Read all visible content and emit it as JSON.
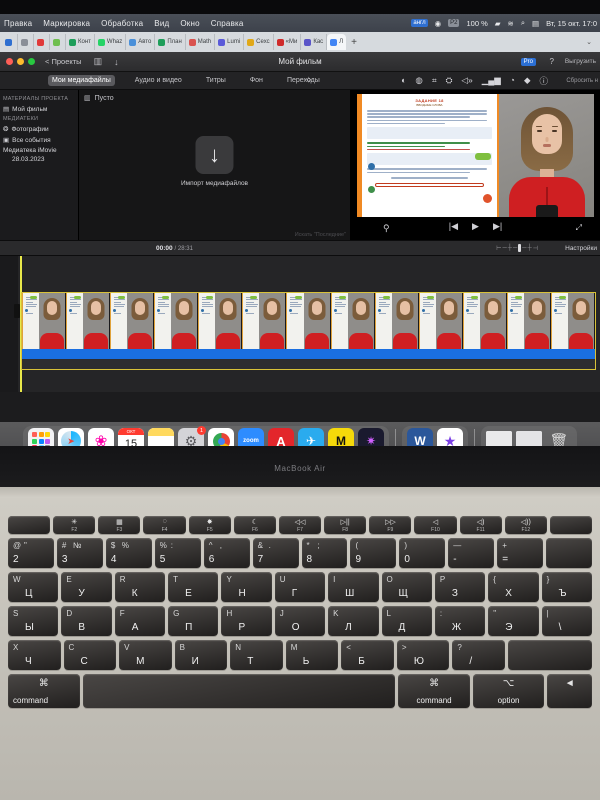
{
  "os_menubar": {
    "apple": "",
    "items": [
      "Правка",
      "Маркировка",
      "Обработка",
      "Вид",
      "Окно",
      "Справка"
    ],
    "status": {
      "input_badge": "англ",
      "record_badge": "P2",
      "battery_pct": "100 %",
      "wifi_icon": "wifi-icon",
      "search_icon": "search-icon",
      "control_center_icon": "control-center-icon",
      "datetime": "Вт, 15 окт. 17:0"
    }
  },
  "browser_tabs": {
    "tabs": [
      {
        "label": "",
        "color": "#2f6fd0"
      },
      {
        "label": "",
        "color": "#8a8f98"
      },
      {
        "label": "",
        "color": "#e03a3a"
      },
      {
        "label": "",
        "color": "#6fbf4f"
      },
      {
        "label": "Конт",
        "color": "#1e9e5a"
      },
      {
        "label": "Whaz",
        "color": "#25d366"
      },
      {
        "label": "Авто",
        "color": "#4a90d9"
      },
      {
        "label": "План",
        "color": "#1e9e5a"
      },
      {
        "label": "Math",
        "color": "#d9534f"
      },
      {
        "label": "Lumi",
        "color": "#5a5ad9"
      },
      {
        "label": "Сехс",
        "color": "#e0a818"
      },
      {
        "label": "«Ми",
        "color": "#cf2b2b"
      },
      {
        "label": "Кас",
        "color": "#5a55c8"
      },
      {
        "label": "Л",
        "color": "#4285f4"
      }
    ],
    "new_tab": "+",
    "tab_list_chevron": "⌄"
  },
  "imovie": {
    "title": "Мой фильм",
    "back_label": "< Проекты",
    "pro_badge": "Pro",
    "help_badge": "?",
    "share_label": "Выгрузить",
    "traffic_lights": [
      "#ff5f57",
      "#febc2e",
      "#28c840"
    ],
    "titlebar_icons": [
      "media-grid-icon",
      "download-icon"
    ],
    "tabs": [
      {
        "label": "Мои медиафайлы",
        "selected": true
      },
      {
        "label": "Аудио и видео",
        "selected": false
      },
      {
        "label": "Титры",
        "selected": false
      },
      {
        "label": "Фон",
        "selected": false
      },
      {
        "label": "Переходы",
        "selected": false
      }
    ],
    "magic_wand_icon": "magic-wand-icon",
    "adjust_icons": [
      "color-balance-icon",
      "color-correction-icon",
      "crop-icon",
      "stabilization-icon",
      "volume-icon",
      "equalizer-icon",
      "speed-icon",
      "filter-icon",
      "info-icon"
    ],
    "reset_label": "Сбросить н",
    "sidebar": {
      "section_project": "МАТЕРИАЛЫ ПРОЕКТА",
      "project_item": "Мой фильм",
      "section_libraries": "МЕДИАТЕКИ",
      "items": [
        {
          "label": "Фотографии",
          "icon": "photos-icon"
        },
        {
          "label": "Все события",
          "icon": "events-icon"
        }
      ],
      "library_name": "Медиатека iMovie",
      "library_date": "28.03.2023"
    },
    "browser": {
      "view_icon": "list-view-icon",
      "empty_label": "Пусто",
      "import_icon": "download-arrow-icon",
      "import_label": "Импорт медиафайлов",
      "search_hint": "Искать \"Последние\""
    },
    "preview": {
      "slide_title": "ЗАДАНИЕ 18",
      "slide_subtitle": "ВВОДНЫЕ СЛОВА",
      "controls": {
        "mic": "microphone-icon",
        "prev": "skip-back-icon",
        "play": "play-icon",
        "next": "skip-forward-icon",
        "fullscreen": "fullscreen-icon"
      }
    },
    "timeline_header": {
      "current_time": "00:00",
      "separator": "/",
      "total_time": "28:31",
      "zoom_slider_icon": "zoom-slider",
      "settings_label": "Настройки"
    },
    "timeline": {
      "clip_count": 13,
      "selection_color": "#d8c139",
      "audio_color": "#1a6fe0",
      "playhead_color": "#e8e84a"
    }
  },
  "dock": {
    "left_group": [
      {
        "name": "launchpad-icon",
        "glyph": "",
        "bg": "#f2f2f4"
      },
      {
        "name": "safari-icon",
        "glyph": "🧭",
        "bg": "#ffffff"
      },
      {
        "name": "photos-icon",
        "glyph": "❀",
        "bg": "#ffffff"
      },
      {
        "name": "calendar-icon",
        "glyph": "15",
        "bg": "#ffffff",
        "top": "ОКТ"
      },
      {
        "name": "notes-icon",
        "glyph": "",
        "bg": "#fde99a"
      },
      {
        "name": "settings-icon",
        "glyph": "⚙",
        "bg": "#d4d4d8",
        "badge": "1"
      },
      {
        "name": "chrome-icon",
        "glyph": "◉",
        "bg": "#ffffff"
      },
      {
        "name": "zoom-icon",
        "glyph": "zoom",
        "bg": "#2d8cff"
      },
      {
        "name": "acrobat-icon",
        "glyph": "A",
        "bg": "#e3262b"
      },
      {
        "name": "telegram-icon",
        "glyph": "✈",
        "bg": "#2aabee"
      },
      {
        "name": "movavi-icon",
        "glyph": "M",
        "bg": "#f5d90a"
      },
      {
        "name": "creative-icon",
        "glyph": "✷",
        "bg": "#1a1a2e"
      }
    ],
    "right_group": [
      {
        "name": "word-icon",
        "glyph": "W",
        "bg": "#2b579a"
      },
      {
        "name": "imovie-icon",
        "glyph": "★",
        "bg": "#ffffff"
      }
    ],
    "files_group": [
      {
        "name": "document-thumbnail-1",
        "glyph": "",
        "bg": "#e9e9ea"
      },
      {
        "name": "document-thumbnail-2",
        "glyph": "",
        "bg": "#e4e4e6"
      },
      {
        "name": "trash-icon",
        "glyph": "🗑",
        "bg": "transparent"
      }
    ]
  },
  "laptop": {
    "model_label": "MacBook Air",
    "fn_row": [
      {
        "glyph": "✳",
        "label": "F2"
      },
      {
        "glyph": "▦",
        "label": "F3"
      },
      {
        "glyph": "◌",
        "label": "F4"
      },
      {
        "glyph": "✸",
        "label": "F5"
      },
      {
        "glyph": "☾",
        "label": "F6"
      },
      {
        "glyph": "◁◁",
        "label": "F7"
      },
      {
        "glyph": "▷||",
        "label": "F8"
      },
      {
        "glyph": "▷▷",
        "label": "F9"
      },
      {
        "glyph": "◁",
        "label": "F10"
      },
      {
        "glyph": "◁)",
        "label": "F11"
      },
      {
        "glyph": "◁))",
        "label": "F12"
      }
    ],
    "number_row": [
      {
        "top": "@",
        "top2": "\"",
        "btm": "2"
      },
      {
        "top": "#",
        "top2": "№",
        "btm": "3"
      },
      {
        "top": "$",
        "top2": "%",
        "btm": "4"
      },
      {
        "top": "%",
        "top2": ":",
        "btm": "5"
      },
      {
        "top": "^",
        "top2": ",",
        "btm": "6"
      },
      {
        "top": "&",
        "top2": ".",
        "btm": "7"
      },
      {
        "top": "*",
        "top2": ";",
        "btm": "8"
      },
      {
        "top": "(",
        "top2": "",
        "btm": "9"
      },
      {
        "top": ")",
        "top2": "",
        "btm": "0"
      },
      {
        "top": "—",
        "top2": "",
        "btm": "-"
      },
      {
        "top": "+",
        "top2": "",
        "btm": "="
      }
    ],
    "qwerty_row": [
      {
        "lat": "W",
        "cyr": "Ц"
      },
      {
        "lat": "E",
        "cyr": "У"
      },
      {
        "lat": "R",
        "cyr": "К"
      },
      {
        "lat": "T",
        "cyr": "Е"
      },
      {
        "lat": "Y",
        "cyr": "Н"
      },
      {
        "lat": "U",
        "cyr": "Г"
      },
      {
        "lat": "I",
        "cyr": "Ш"
      },
      {
        "lat": "O",
        "cyr": "Щ"
      },
      {
        "lat": "P",
        "cyr": "З"
      },
      {
        "lat": "{",
        "cyr": "Х"
      },
      {
        "lat": "}",
        "cyr": "Ъ"
      }
    ],
    "asdf_row": [
      {
        "lat": "S",
        "cyr": "Ы"
      },
      {
        "lat": "D",
        "cyr": "В"
      },
      {
        "lat": "F",
        "cyr": "А"
      },
      {
        "lat": "G",
        "cyr": "П"
      },
      {
        "lat": "H",
        "cyr": "Р"
      },
      {
        "lat": "J",
        "cyr": "О"
      },
      {
        "lat": "K",
        "cyr": "Л"
      },
      {
        "lat": "L",
        "cyr": "Д"
      },
      {
        "lat": ":",
        "cyr": "Ж"
      },
      {
        "lat": "\"",
        "cyr": "Э"
      },
      {
        "lat": "|",
        "cyr": "\\"
      }
    ],
    "zxcv_row": [
      {
        "lat": "X",
        "cyr": "Ч"
      },
      {
        "lat": "C",
        "cyr": "С"
      },
      {
        "lat": "V",
        "cyr": "М"
      },
      {
        "lat": "B",
        "cyr": "И"
      },
      {
        "lat": "N",
        "cyr": "Т"
      },
      {
        "lat": "M",
        "cyr": "Ь"
      },
      {
        "lat": "<",
        "cyr": "Б"
      },
      {
        "lat": ">",
        "cyr": "Ю"
      },
      {
        "lat": "?",
        "cyr": "/"
      }
    ],
    "bottom_row": {
      "command_left": "command",
      "cmd_glyph": "⌘",
      "space": "",
      "command_right": "command",
      "option": "option",
      "option_glyph": "⌥",
      "arrow_left": "◄"
    }
  }
}
